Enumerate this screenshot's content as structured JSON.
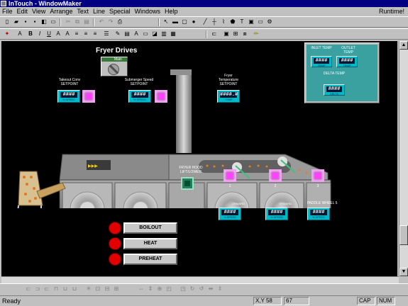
{
  "window": {
    "title": "InTouch - WindowMaker",
    "runtime_label": "Runtime!"
  },
  "menu": [
    "File",
    "Edit",
    "View",
    "Arrange",
    "Text",
    "Line",
    "Special",
    "Windows",
    "Help"
  ],
  "screen": {
    "title": "Fryer Drives",
    "switch_label": "Main",
    "setpoints": [
      {
        "label": "Takeout Conv SETPOINT",
        "value": "####",
        "sub": "% SPEED"
      },
      {
        "label": "Submerger Speed SETPOINT",
        "value": "####",
        "sub": "% SPEED"
      },
      {
        "label": "Fryer Temperature SETPOINT",
        "value": "####.#",
        "sub": "TEMP"
      }
    ],
    "temp_panel": {
      "inlet_label": "INLET TEMP",
      "inlet_value": "####",
      "inlet_sub": "TEMP",
      "outlet_label": "OUTLET TEMP",
      "outlet_value": "####",
      "outlet_sub": "TEMP",
      "delta_label": "DELTA TEMP",
      "delta_value": "####",
      "delta_sub": "DELTA"
    },
    "hood_label": "FRYER HOOD LIFT/LOWER",
    "unit_numbers": [
      "1",
      "2",
      "3"
    ],
    "bottom_readouts": [
      {
        "label": "ORWARD",
        "value": "####",
        "sub": "% SPEED"
      },
      {
        "label": "ORWARD",
        "value": "####",
        "sub": "% SPEED"
      },
      {
        "label": "PADDLE WHEEL 5",
        "value": "####",
        "sub": "% SPEED"
      }
    ],
    "controls": [
      "BOILOUT",
      "HEAT",
      "PREHEAT"
    ]
  },
  "status": {
    "text": "Ready",
    "xy_label": "X,Y",
    "x": "58",
    "y": "67",
    "cap": "CAP",
    "num": "NUM"
  },
  "colors": {
    "titlebar": "#000080",
    "canvas": "#000000",
    "readout": "#00b8c8",
    "indicator": "#ff40ff",
    "alarm_button": "#e00000"
  }
}
